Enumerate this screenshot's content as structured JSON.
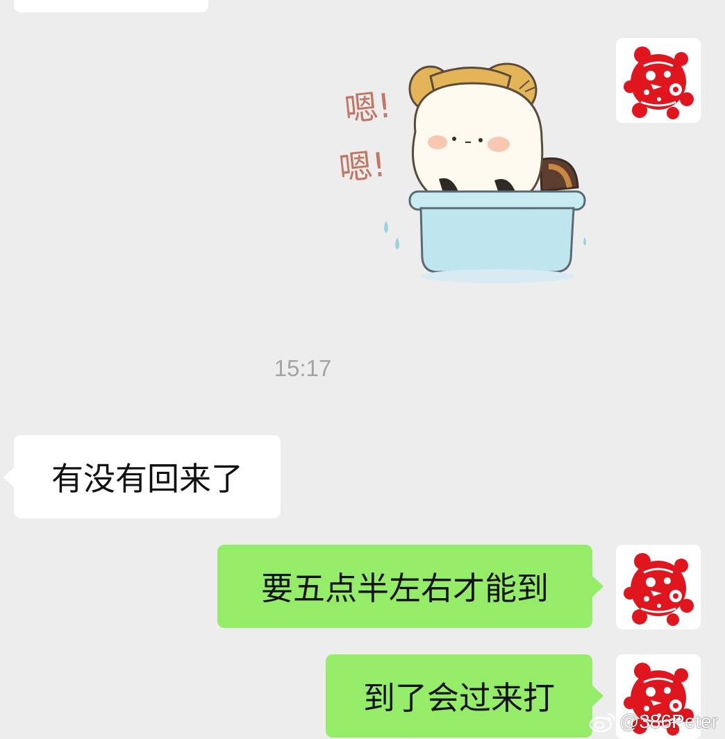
{
  "timestamp": "15:17",
  "messages": [
    {
      "side": "right",
      "type": "sticker",
      "sticker_text": [
        "嗯!",
        "嗯!"
      ],
      "sticker_name": "dog-in-bathtub-sticker"
    },
    {
      "side": "left",
      "type": "text",
      "text": "有没有回来了"
    },
    {
      "side": "right",
      "type": "text",
      "text": "要五点半左右才能到"
    },
    {
      "side": "right",
      "type": "text",
      "text": "到了会过来打"
    }
  ],
  "watermark": {
    "handle": "@386Peter",
    "icon": "weibo-icon"
  },
  "colors": {
    "background": "#ededed",
    "incoming_bubble": "#ffffff",
    "outgoing_bubble": "#95ec69",
    "timestamp_text": "#a3a3a3",
    "papercut_red": "#e0161e",
    "sticker_text": "#c27764"
  }
}
